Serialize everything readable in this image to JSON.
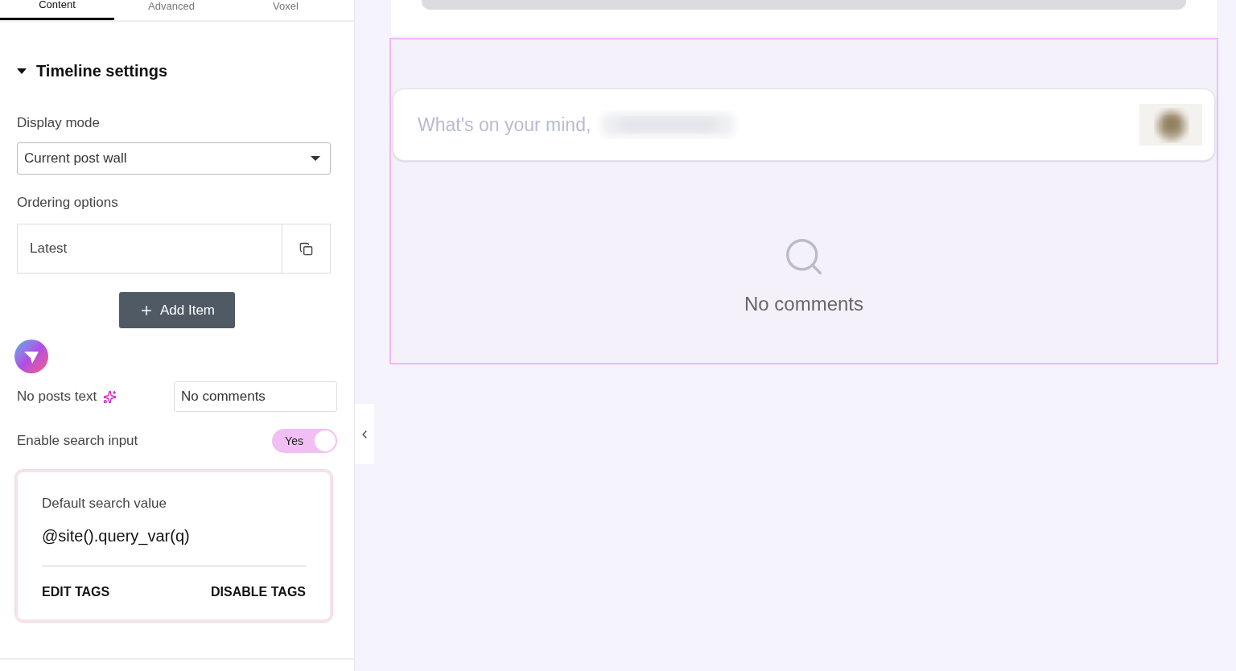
{
  "tabs": [
    {
      "label": "Content",
      "selected": true
    },
    {
      "label": "Advanced",
      "selected": false
    },
    {
      "label": "Voxel",
      "selected": false
    }
  ],
  "section": {
    "title": "Timeline settings",
    "expanded": true
  },
  "display_mode": {
    "label": "Display mode",
    "value": "Current post wall"
  },
  "ordering": {
    "label": "Ordering options",
    "items": [
      "Latest"
    ]
  },
  "add_button": "Add Item",
  "no_posts": {
    "label": "No posts text",
    "value": "No comments"
  },
  "search_toggle": {
    "label": "Enable search input",
    "on": true,
    "text": "Yes"
  },
  "tag_card": {
    "label": "Default search value",
    "value": "@site().query_var(q)",
    "actions": [
      "EDIT TAGS",
      "DISABLE TAGS"
    ]
  },
  "preview": {
    "composer_placeholder": "What's on your mind,",
    "empty_text": "No comments"
  }
}
